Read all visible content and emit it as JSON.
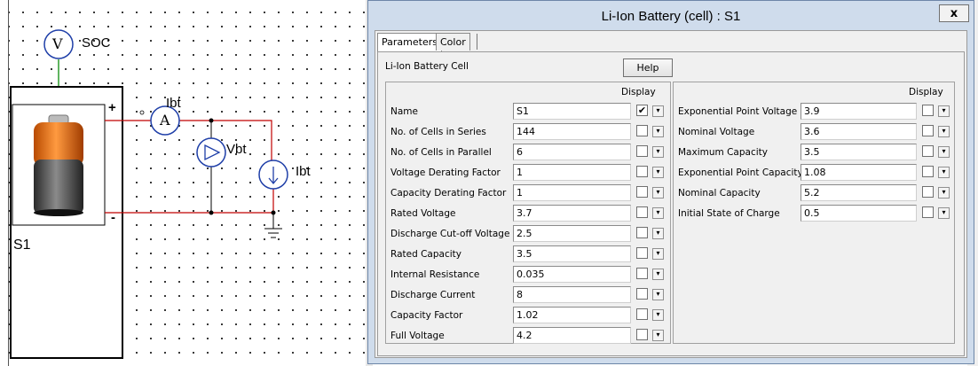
{
  "schematic": {
    "voltmeter_symbol": "V",
    "soc_label": "SOC",
    "ammeter_symbol": "A",
    "ibt_label": "Ibt",
    "vbt_label": "Vbt",
    "ibt_source_label": "Ibt",
    "plus_sign": "+",
    "minus_sign": "-",
    "battery_label": "S1",
    "battery_icon": "battery-icon",
    "wire_color": "#c00000"
  },
  "dialog": {
    "title": "Li-Ion Battery (cell) : S1",
    "close_label": "x",
    "tabs": [
      "Parameters",
      "Color"
    ],
    "section_label": "Li-Ion Battery Cell",
    "help_label": "Help",
    "display_header": "Display",
    "left_params": [
      {
        "label": "Name",
        "value": "S1",
        "display": true
      },
      {
        "label": "No. of Cells in Series",
        "value": "144",
        "display": false
      },
      {
        "label": "No. of Cells in Parallel",
        "value": "6",
        "display": false
      },
      {
        "label": "Voltage Derating Factor",
        "value": "1",
        "display": false
      },
      {
        "label": "Capacity Derating Factor",
        "value": "1",
        "display": false
      },
      {
        "label": "Rated Voltage",
        "value": "3.7",
        "display": false
      },
      {
        "label": "Discharge Cut-off Voltage",
        "value": "2.5",
        "display": false
      },
      {
        "label": "Rated Capacity",
        "value": "3.5",
        "display": false
      },
      {
        "label": "Internal Resistance",
        "value": "0.035",
        "display": false
      },
      {
        "label": "Discharge Current",
        "value": "8",
        "display": false
      },
      {
        "label": "Capacity Factor",
        "value": "1.02",
        "display": false
      },
      {
        "label": "Full Voltage",
        "value": "4.2",
        "display": false
      }
    ],
    "right_params": [
      {
        "label": "Exponential Point Voltage",
        "value": "3.9",
        "display": false
      },
      {
        "label": "Nominal Voltage",
        "value": "3.6",
        "display": false
      },
      {
        "label": "Maximum Capacity",
        "value": "3.5",
        "display": false
      },
      {
        "label": "Exponential Point Capacity",
        "value": "1.08",
        "display": false
      },
      {
        "label": "Nominal Capacity",
        "value": "5.2",
        "display": false
      },
      {
        "label": "Initial State of Charge",
        "value": "0.5",
        "display": false
      }
    ]
  }
}
